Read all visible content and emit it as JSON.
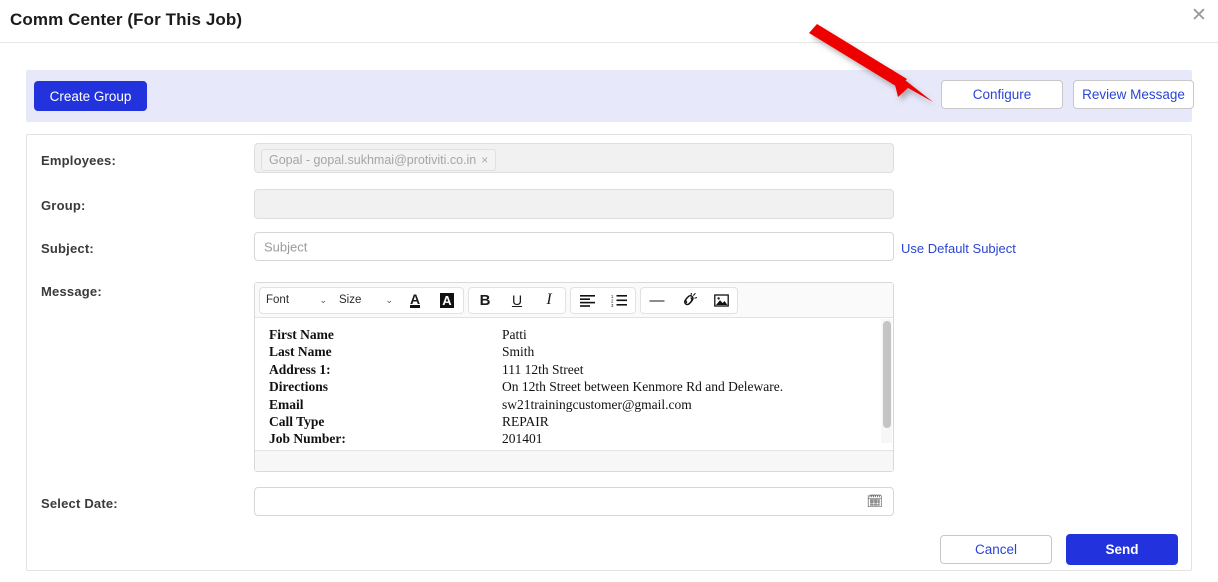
{
  "header": {
    "title": "Comm Center (For This Job)",
    "close_icon": "close-icon",
    "close_glyph": "✕"
  },
  "action_bar": {
    "create_group_label": "Create Group",
    "configure_label": "Configure",
    "review_message_label": "Review Message",
    "background_color": "#e7e9fb",
    "primary_color": "#2233dd",
    "link_color": "#2b45d4"
  },
  "annotation": {
    "type": "arrow",
    "color": "#ee0000",
    "points_to": "Configure"
  },
  "form": {
    "employees": {
      "label": "Employees:",
      "chip_text": "Gopal - gopal.sukhmai@protiviti.co.in",
      "chip_remove_glyph": "×",
      "disabled": true
    },
    "group": {
      "label": "Group:",
      "value": "",
      "disabled": true
    },
    "subject": {
      "label": "Subject:",
      "placeholder": "Subject",
      "value": "",
      "default_link_label": "Use Default Subject"
    },
    "message": {
      "label": "Message:",
      "toolbar": {
        "font_label": "Font",
        "size_label": "Size",
        "font_color_glyph": "A",
        "highlight_glyph": "A",
        "bold_glyph": "B",
        "underline_glyph": "U",
        "italic_glyph": "I",
        "align_left_name": "align-left-icon",
        "ordered_list_name": "ordered-list-icon",
        "horizontal_rule_glyph": "—",
        "link_name": "unlink-icon",
        "image_name": "image-icon",
        "caret_glyph": "⌄"
      },
      "body_rows": [
        {
          "key": "First Name",
          "value": "Patti"
        },
        {
          "key": "Last Name",
          "value": "Smith"
        },
        {
          "key": "Address 1:",
          "value": "111 12th Street"
        },
        {
          "key": "Directions",
          "value": "On 12th Street between Kenmore Rd and Deleware."
        },
        {
          "key": "Email",
          "value": "sw21trainingcustomer@gmail.com"
        },
        {
          "key": "Call Type",
          "value": "REPAIR"
        },
        {
          "key": "Job Number:",
          "value": "201401"
        }
      ]
    },
    "select_date": {
      "label": "Select Date:",
      "value": "",
      "calendar_glyph": "🗓"
    }
  },
  "footer": {
    "cancel_label": "Cancel",
    "send_label": "Send"
  }
}
